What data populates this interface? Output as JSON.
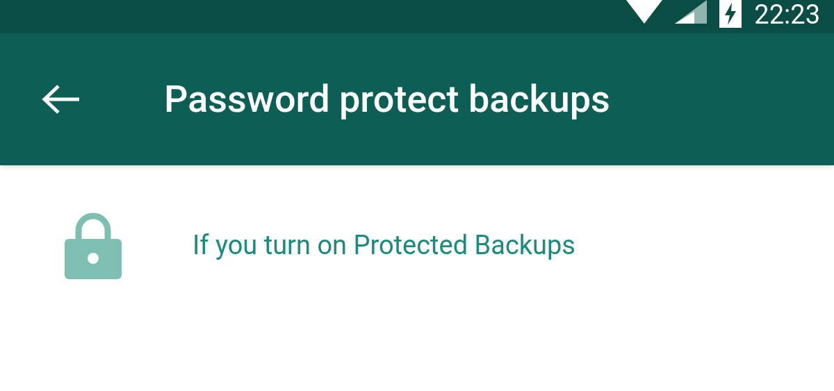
{
  "status_bar": {
    "time": "22:23"
  },
  "toolbar": {
    "title": "Password protect backups"
  },
  "content": {
    "text": "If you turn on Protected Backups"
  }
}
